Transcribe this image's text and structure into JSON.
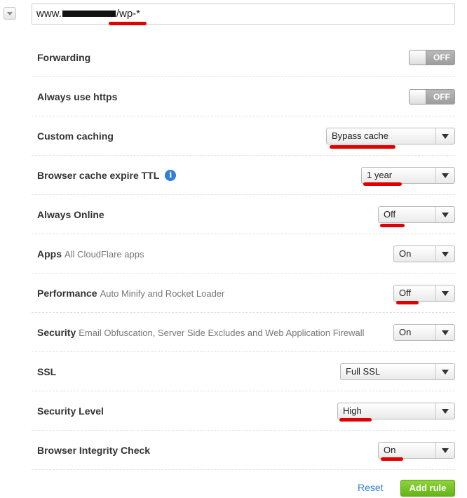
{
  "url_pattern": {
    "prefix": "www.",
    "suffix": "/wp-*"
  },
  "rows": {
    "forwarding": {
      "label": "Forwarding",
      "state": "OFF"
    },
    "always_https": {
      "label": "Always use https",
      "state": "OFF"
    },
    "custom_caching": {
      "label": "Custom caching",
      "value": "Bypass cache"
    },
    "browser_cache_ttl": {
      "label": "Browser cache expire TTL",
      "value": "1 year",
      "info_icon": "i"
    },
    "always_online": {
      "label": "Always Online",
      "value": "Off"
    },
    "apps": {
      "label": "Apps",
      "desc": "All CloudFlare apps",
      "value": "On"
    },
    "performance": {
      "label": "Performance",
      "desc": "Auto Minify and Rocket Loader",
      "value": "Off"
    },
    "security": {
      "label": "Security",
      "desc": "Email Obfuscation, Server Side Excludes and Web Application Firewall",
      "value": "On"
    },
    "ssl": {
      "label": "SSL",
      "value": "Full SSL"
    },
    "security_level": {
      "label": "Security Level",
      "value": "High"
    },
    "browser_integrity": {
      "label": "Browser Integrity Check",
      "value": "On"
    }
  },
  "actions": {
    "reset": "Reset",
    "add_rule": "Add rule"
  },
  "colors": {
    "accent_blue": "#2f7fd8",
    "add_green": "#63b417",
    "annotation_red": "#e00000"
  },
  "icons": {
    "collapse": "chevron-down-icon",
    "info": "info-icon",
    "select_arrow": "caret-down-icon"
  }
}
